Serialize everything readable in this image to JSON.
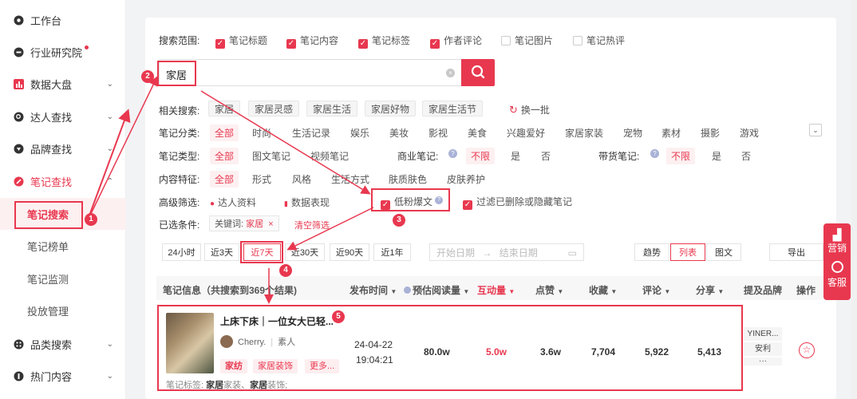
{
  "sidebar": {
    "items": [
      {
        "label": "工作台",
        "icon": "dashboard-icon"
      },
      {
        "label": "行业研究院",
        "icon": "compass-icon"
      },
      {
        "label": "数据大盘",
        "icon": "bar-chart-icon"
      },
      {
        "label": "达人查找",
        "icon": "search-person-icon"
      },
      {
        "label": "品牌查找",
        "icon": "brand-icon"
      },
      {
        "label": "笔记查找",
        "icon": "note-search-icon"
      }
    ],
    "sub_items": [
      "笔记搜索",
      "笔记榜单",
      "笔记监测",
      "投放管理"
    ],
    "bottom_items": [
      {
        "label": "品类搜索",
        "icon": "category-icon"
      },
      {
        "label": "热门内容",
        "icon": "hot-content-icon"
      }
    ]
  },
  "scope": {
    "label": "搜索范围:",
    "options": [
      {
        "label": "笔记标题",
        "checked": true
      },
      {
        "label": "笔记内容",
        "checked": true
      },
      {
        "label": "笔记标签",
        "checked": true
      },
      {
        "label": "作者评论",
        "checked": true
      },
      {
        "label": "笔记图片",
        "checked": false
      },
      {
        "label": "笔记热评",
        "checked": false
      }
    ]
  },
  "search": {
    "value": "家居"
  },
  "related": {
    "label": "相关搜索:",
    "tags": [
      "家居",
      "家居灵感",
      "家居生活",
      "家居好物",
      "家居生活节"
    ],
    "refresh": "换一批"
  },
  "category": {
    "label": "笔记分类:",
    "options": [
      "全部",
      "时尚",
      "生活记录",
      "娱乐",
      "美妆",
      "影视",
      "美食",
      "兴趣爱好",
      "家居家装",
      "宠物",
      "素材",
      "摄影",
      "游戏"
    ]
  },
  "note_type": {
    "label": "笔记类型:",
    "options": [
      "全部",
      "图文笔记",
      "视频笔记"
    ],
    "commercial_label": "商业笔记:",
    "commercial_options": [
      "不限",
      "是",
      "否"
    ],
    "goods_label": "带货笔记:",
    "goods_options": [
      "不限",
      "是",
      "否"
    ]
  },
  "content": {
    "label": "内容特征:",
    "options": [
      "全部",
      "形式",
      "风格",
      "生活方式",
      "肤质肤色",
      "皮肤养护"
    ]
  },
  "advanced": {
    "label": "高级筛选:",
    "influencer": "达人资料",
    "data": "数据表现",
    "low_fans": "低粉爆文",
    "filter_deleted": "过滤已删除或隐藏笔记"
  },
  "selected": {
    "label": "已选条件:",
    "keyword_prefix": "关键词:",
    "keyword": "家居",
    "clear": "清空筛选"
  },
  "time_tabs": [
    "24小时",
    "近3天",
    "近7天",
    "近30天",
    "近90天",
    "近1年"
  ],
  "date_range": {
    "start": "开始日期",
    "arrow": "→",
    "end": "结束日期"
  },
  "view_tabs": [
    "趋势",
    "列表",
    "图文"
  ],
  "export_label": "导出",
  "table": {
    "headers": {
      "info": "笔记信息（共搜索到369个结果)",
      "publish": "发布时间",
      "est_read": "预估阅读量",
      "interact": "互动量",
      "like": "点赞",
      "fav": "收藏",
      "comment": "评论",
      "share": "分享",
      "brand": "提及品牌",
      "action": "操作"
    },
    "rows": [
      {
        "title": "上床下床｜一位女大已轻...",
        "author": "Cherry.",
        "author_type": "素人",
        "tags": [
          "家纺",
          "家居装饰",
          "更多..."
        ],
        "note_tags_label": "笔记标签:",
        "note_tags_1_bold": "家居",
        "note_tags_1_rest": "家装、",
        "note_tags_2_bold": "家居",
        "note_tags_2_rest": "装饰;",
        "date": "24-04-22",
        "time": "19:04:21",
        "est_read": "80.0w",
        "interact": "5.0w",
        "like": "3.6w",
        "fav": "7,704",
        "comment": "5,922",
        "share": "5,413",
        "brand_1": "YINER...",
        "brand_2": "安利",
        "brand_more": "···"
      }
    ]
  },
  "float_bar": {
    "marketing": "营销",
    "service": "客服"
  },
  "badges": [
    "1",
    "2",
    "3",
    "4",
    "5"
  ],
  "accent": "#e8384f"
}
